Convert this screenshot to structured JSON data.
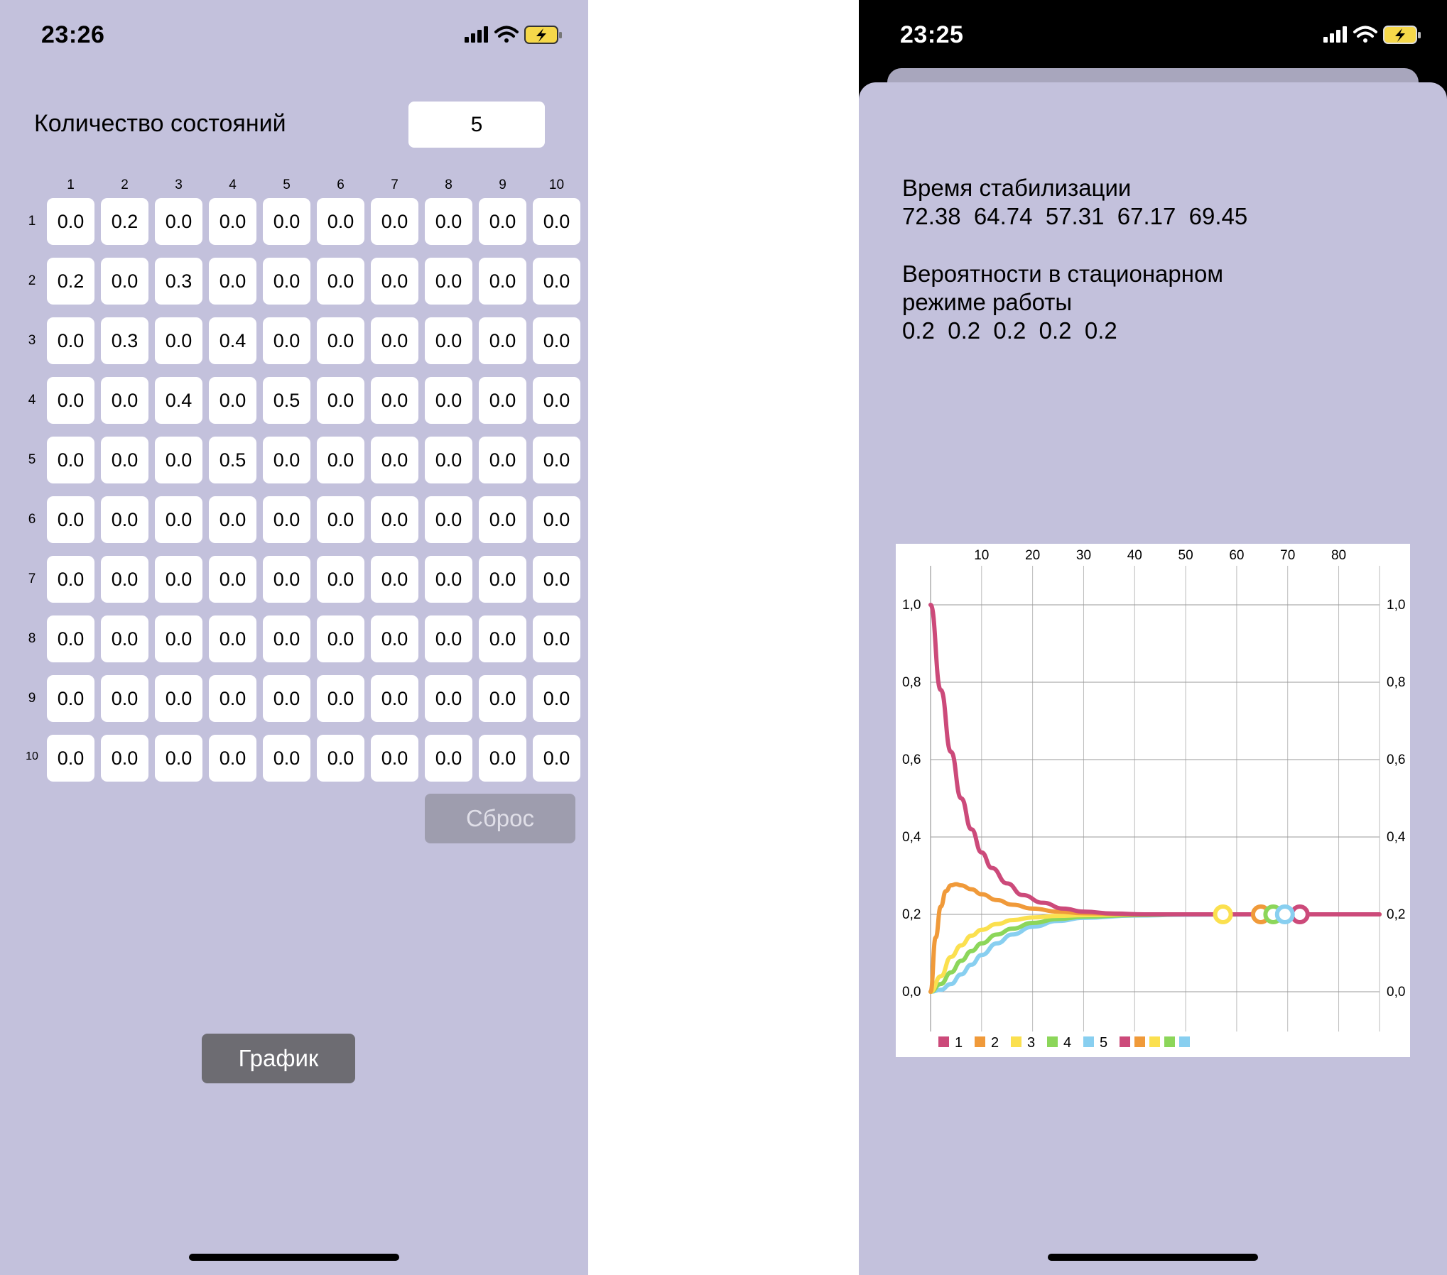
{
  "left_screen": {
    "status": {
      "time": "23:26"
    },
    "states_label": "Количество состояний",
    "states_value": "5",
    "column_headers": [
      "1",
      "2",
      "3",
      "4",
      "5",
      "6",
      "7",
      "8",
      "9",
      "10"
    ],
    "row_headers": [
      "1",
      "2",
      "3",
      "4",
      "5",
      "6",
      "7",
      "8",
      "9",
      "10"
    ],
    "matrix": [
      [
        "0.0",
        "0.2",
        "0.0",
        "0.0",
        "0.0",
        "0.0",
        "0.0",
        "0.0",
        "0.0",
        "0.0"
      ],
      [
        "0.2",
        "0.0",
        "0.3",
        "0.0",
        "0.0",
        "0.0",
        "0.0",
        "0.0",
        "0.0",
        "0.0"
      ],
      [
        "0.0",
        "0.3",
        "0.0",
        "0.4",
        "0.0",
        "0.0",
        "0.0",
        "0.0",
        "0.0",
        "0.0"
      ],
      [
        "0.0",
        "0.0",
        "0.4",
        "0.0",
        "0.5",
        "0.0",
        "0.0",
        "0.0",
        "0.0",
        "0.0"
      ],
      [
        "0.0",
        "0.0",
        "0.0",
        "0.5",
        "0.0",
        "0.0",
        "0.0",
        "0.0",
        "0.0",
        "0.0"
      ],
      [
        "0.0",
        "0.0",
        "0.0",
        "0.0",
        "0.0",
        "0.0",
        "0.0",
        "0.0",
        "0.0",
        "0.0"
      ],
      [
        "0.0",
        "0.0",
        "0.0",
        "0.0",
        "0.0",
        "0.0",
        "0.0",
        "0.0",
        "0.0",
        "0.0"
      ],
      [
        "0.0",
        "0.0",
        "0.0",
        "0.0",
        "0.0",
        "0.0",
        "0.0",
        "0.0",
        "0.0",
        "0.0"
      ],
      [
        "0.0",
        "0.0",
        "0.0",
        "0.0",
        "0.0",
        "0.0",
        "0.0",
        "0.0",
        "0.0",
        "0.0"
      ],
      [
        "0.0",
        "0.0",
        "0.0",
        "0.0",
        "0.0",
        "0.0",
        "0.0",
        "0.0",
        "0.0",
        "0.0"
      ]
    ],
    "reset_button": "Сброс",
    "graph_button": "График"
  },
  "right_screen": {
    "status": {
      "time": "23:25"
    },
    "stabilization_title": "Время стабилизации",
    "stabilization_values": "72.38  64.74  57.31  67.17  69.45",
    "stationary_title_line1": "Вероятности в стационарном",
    "stationary_title_line2": "режиме работы",
    "stationary_values": "0.2  0.2  0.2  0.2  0.2"
  },
  "colors": {
    "screen_background": "#c3c1dc",
    "series": [
      "#cc4a7a",
      "#f09a3a",
      "#fbe04f",
      "#8cd65a",
      "#88cff0"
    ]
  },
  "chart_data": {
    "type": "line",
    "x_ticks": [
      10,
      20,
      30,
      40,
      50,
      60,
      70,
      80
    ],
    "y_ticks": [
      "0,0",
      "0,2",
      "0,4",
      "0,6",
      "0,8",
      "1,0"
    ],
    "xlim": [
      0,
      88
    ],
    "ylim": [
      0,
      1.0
    ],
    "grid": true,
    "legend_position": "bottom-left",
    "series": [
      {
        "name": "1",
        "x": [
          0,
          2,
          4,
          6,
          8,
          10,
          12,
          15,
          18,
          22,
          26,
          30,
          36,
          42,
          50,
          60,
          72.38,
          88
        ],
        "y": [
          1.0,
          0.78,
          0.62,
          0.5,
          0.42,
          0.36,
          0.32,
          0.28,
          0.25,
          0.23,
          0.215,
          0.207,
          0.202,
          0.2,
          0.2,
          0.2,
          0.2,
          0.2
        ],
        "marker_x": 72.38
      },
      {
        "name": "2",
        "x": [
          0,
          1,
          2,
          3,
          4,
          5,
          6,
          8,
          10,
          13,
          16,
          20,
          25,
          30,
          40,
          50,
          64.74,
          88
        ],
        "y": [
          0,
          0.14,
          0.22,
          0.26,
          0.275,
          0.278,
          0.275,
          0.265,
          0.252,
          0.237,
          0.225,
          0.215,
          0.207,
          0.203,
          0.2,
          0.2,
          0.2,
          0.2
        ],
        "marker_x": 64.74
      },
      {
        "name": "3",
        "x": [
          0,
          2,
          4,
          6,
          8,
          10,
          13,
          16,
          20,
          25,
          30,
          40,
          57.31,
          88
        ],
        "y": [
          0,
          0.04,
          0.09,
          0.12,
          0.145,
          0.16,
          0.175,
          0.185,
          0.192,
          0.196,
          0.198,
          0.2,
          0.2,
          0.2
        ],
        "marker_x": 57.31
      },
      {
        "name": "4",
        "x": [
          0,
          2,
          4,
          6,
          8,
          10,
          13,
          16,
          20,
          25,
          30,
          40,
          50,
          67.17,
          88
        ],
        "y": [
          0,
          0.02,
          0.05,
          0.08,
          0.105,
          0.125,
          0.148,
          0.163,
          0.178,
          0.188,
          0.194,
          0.198,
          0.2,
          0.2,
          0.2
        ],
        "marker_x": 67.17
      },
      {
        "name": "5",
        "x": [
          0,
          2,
          4,
          6,
          8,
          10,
          13,
          16,
          20,
          25,
          30,
          40,
          50,
          69.45,
          88
        ],
        "y": [
          0,
          0.005,
          0.02,
          0.045,
          0.07,
          0.095,
          0.125,
          0.148,
          0.168,
          0.183,
          0.191,
          0.197,
          0.199,
          0.2,
          0.2
        ],
        "marker_x": 69.45
      }
    ]
  }
}
